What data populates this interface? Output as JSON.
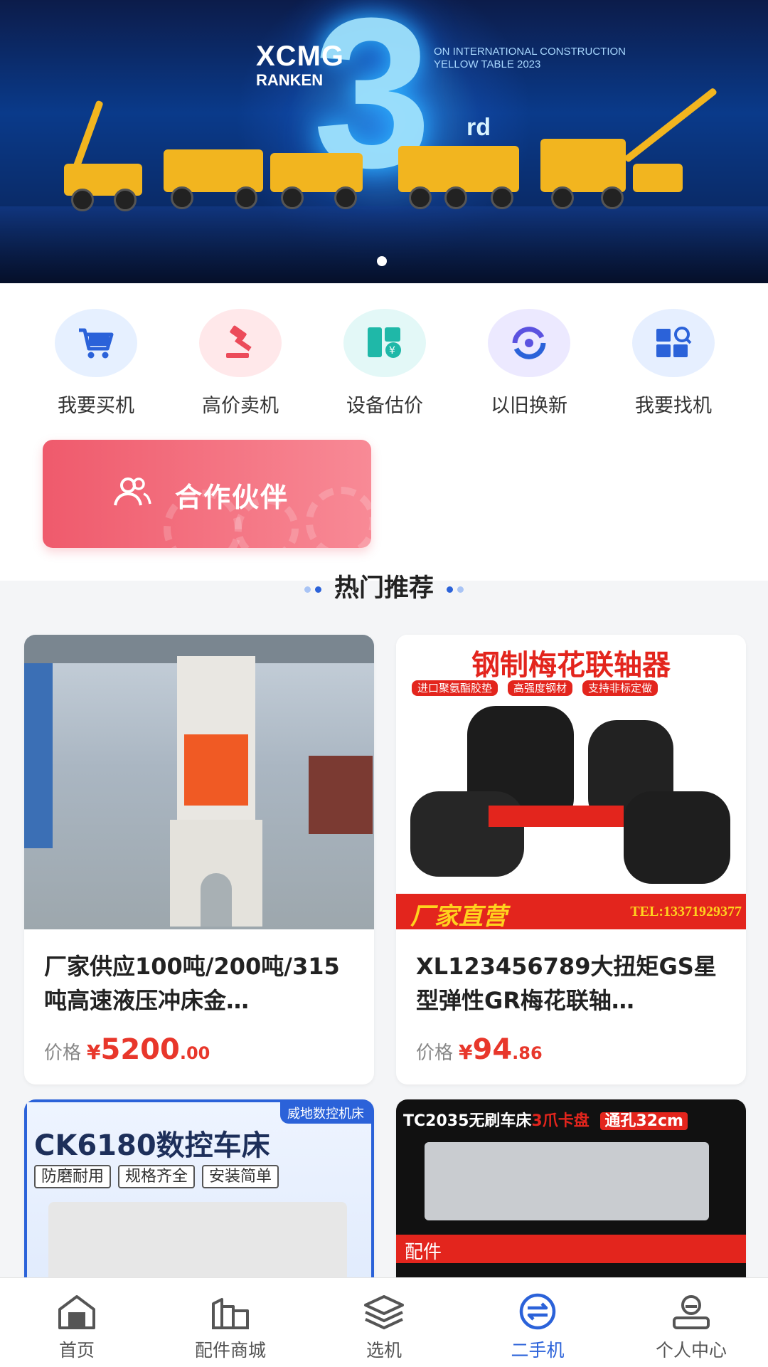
{
  "banner": {
    "brand_line1": "XCMG",
    "brand_line2": "RANKEN",
    "big_number": "3",
    "suffix": "rd",
    "tagline_1": "ON INTERNATIONAL CONSTRUCTION",
    "tagline_2": "YELLOW TABLE 2023",
    "active_slide": 1,
    "slide_count": 1
  },
  "quick_nav": [
    {
      "label": "我要买机",
      "icon": "shopping-cart-icon",
      "bg": "#e6f0ff"
    },
    {
      "label": "高价卖机",
      "icon": "gavel-icon",
      "bg": "#ffe8ea"
    },
    {
      "label": "设备估价",
      "icon": "valuation-icon",
      "bg": "#e3f8f7"
    },
    {
      "label": "以旧换新",
      "icon": "exchange-icon",
      "bg": "#ece9ff"
    },
    {
      "label": "我要找机",
      "icon": "search-machine-icon",
      "bg": "#e6efff"
    }
  ],
  "partner": {
    "label": "合作伙伴",
    "icon": "people-icon"
  },
  "section": {
    "title": "热门推荐"
  },
  "products": [
    {
      "title": "厂家供应100吨/200吨/315吨高速液压冲床金…",
      "price_label": "价格",
      "currency": "¥",
      "price_int": "5200",
      "price_dec": ".00"
    },
    {
      "title": "XL123456789大扭矩GS星型弹性GR梅花联轴…",
      "price_label": "价格",
      "currency": "¥",
      "price_int": "94",
      "price_dec": ".86",
      "img_heading": "钢制梅花联轴器",
      "img_tags": [
        "进口聚氨酯胶垫",
        "高强度钢材",
        "支持非标定做"
      ],
      "img_footer_left": "厂家直营",
      "img_footer_right": "TEL:13371929377"
    },
    {
      "img_corner": "威地数控机床",
      "img_heading": "CK6180数控车床",
      "img_tags": [
        "防磨耐用",
        "规格齐全",
        "安装简单"
      ]
    },
    {
      "img_heading": "TC2035无刷车床",
      "img_tag1": "3爪卡盘",
      "img_tag2": "通孔32cm",
      "img_footer": "配件"
    }
  ],
  "tabbar": [
    {
      "label": "首页",
      "icon": "home-icon",
      "active": false
    },
    {
      "label": "配件商城",
      "icon": "store-icon",
      "active": false
    },
    {
      "label": "选机",
      "icon": "layers-icon",
      "active": false
    },
    {
      "label": "二手机",
      "icon": "second-hand-icon",
      "active": true
    },
    {
      "label": "个人中心",
      "icon": "user-icon",
      "active": false
    }
  ],
  "colors": {
    "accent": "#2b62d9",
    "price": "#e8372b",
    "partner_start": "#ef5a6c",
    "partner_end": "#f88a96"
  }
}
